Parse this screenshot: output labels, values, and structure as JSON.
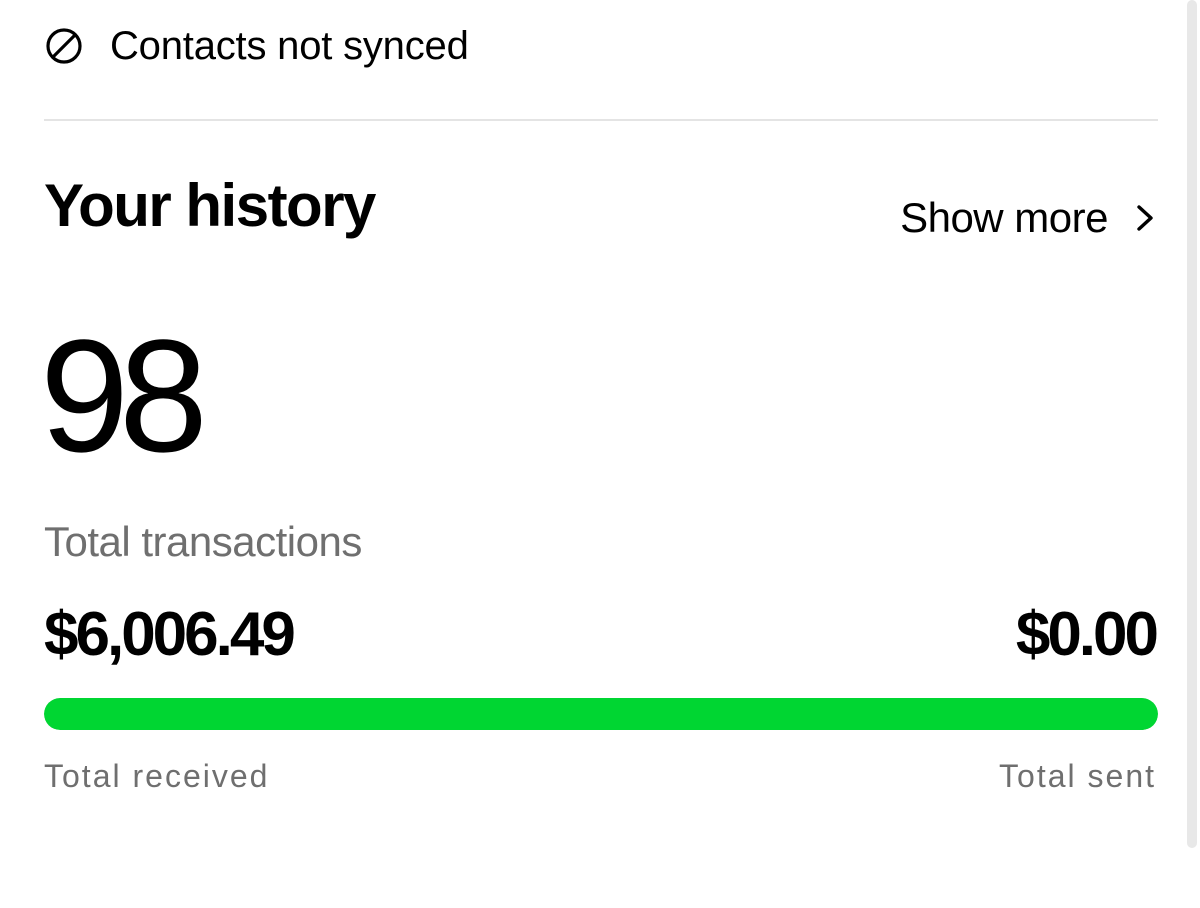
{
  "sync_status": {
    "icon": "not-synced-icon",
    "label": "Contacts not synced"
  },
  "history": {
    "title": "Your history",
    "show_more_label": "Show more",
    "show_more_icon": "chevron-right-icon",
    "transaction_count": "98",
    "transaction_count_label": "Total transactions",
    "total_received": "$6,006.49",
    "total_sent": "$0.00",
    "total_received_label": "Total received",
    "total_sent_label": "Total sent",
    "received_fraction": 1.0
  },
  "colors": {
    "accent": "#00D632",
    "secondary_text": "#6f6f6f",
    "divider": "#e4e4e4"
  }
}
